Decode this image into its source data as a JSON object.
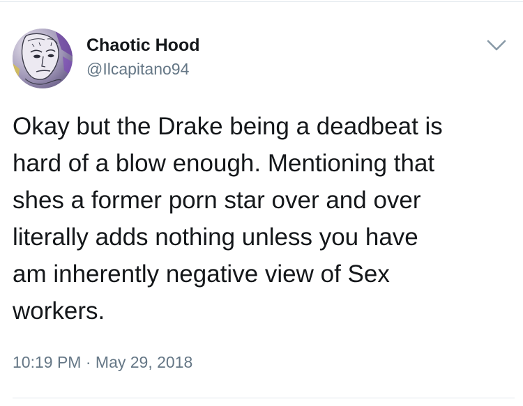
{
  "tweet": {
    "author": {
      "display_name": "Chaotic Hood",
      "handle": "@Ilcapitano94",
      "avatar": "avatar-sketch-face"
    },
    "menu_icon": "chevron-down-icon",
    "text_lines": [
      "Okay but the Drake being a deadbeat is",
      "hard of a blow enough. Mentioning that",
      "shes a former porn star over and over",
      "literally adds nothing unless you have",
      "am inherently negative view of Sex",
      "workers."
    ],
    "time": "10:19 PM",
    "separator": "·",
    "date": "May 29, 2018"
  },
  "colors": {
    "text": "#14171a",
    "secondary": "#657786",
    "divider": "#e1e8ed",
    "caret": "#8899a6"
  }
}
